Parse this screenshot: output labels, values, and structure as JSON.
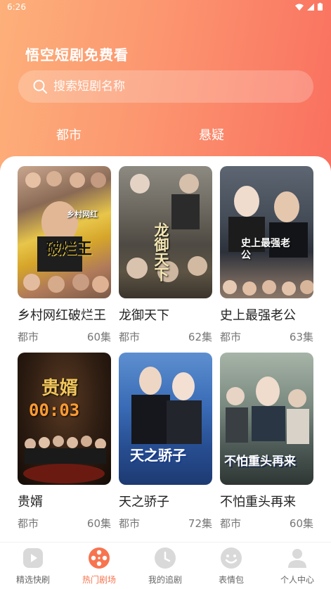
{
  "status": {
    "time": "6:26"
  },
  "app": {
    "title": "悟空短剧免费看"
  },
  "search": {
    "placeholder": "搜索短剧名称"
  },
  "tabs": [
    {
      "label": "都市"
    },
    {
      "label": "悬疑"
    }
  ],
  "posters": {
    "p1_tag": "乡村网红",
    "p1_main": "破烂王",
    "p2_main": "龙御天下",
    "p3_main": "史上最强老公",
    "p4_main": "贵婿",
    "p4_counter": "00:03",
    "p5_main": "天之骄子",
    "p6_main": "不怕重头再来"
  },
  "dramas": [
    {
      "title": "乡村网红破烂王",
      "genre": "都市",
      "episodes": "60集"
    },
    {
      "title": "龙御天下",
      "genre": "都市",
      "episodes": "62集"
    },
    {
      "title": "史上最强老公",
      "genre": "都市",
      "episodes": "63集"
    },
    {
      "title": "贵婿",
      "genre": "都市",
      "episodes": "60集"
    },
    {
      "title": "天之骄子",
      "genre": "都市",
      "episodes": "72集"
    },
    {
      "title": "不怕重头再来",
      "genre": "都市",
      "episodes": "60集"
    }
  ],
  "nav": [
    {
      "label": "精选快刷",
      "icon": "play-icon"
    },
    {
      "label": "热门剧场",
      "icon": "film-reel-icon"
    },
    {
      "label": "我的追剧",
      "icon": "clock-icon"
    },
    {
      "label": "表情包",
      "icon": "smiley-icon"
    },
    {
      "label": "个人中心",
      "icon": "person-icon"
    }
  ],
  "colors": {
    "accent": "#f7744f",
    "header_start": "#fdb07a",
    "header_end": "#f9705f"
  }
}
